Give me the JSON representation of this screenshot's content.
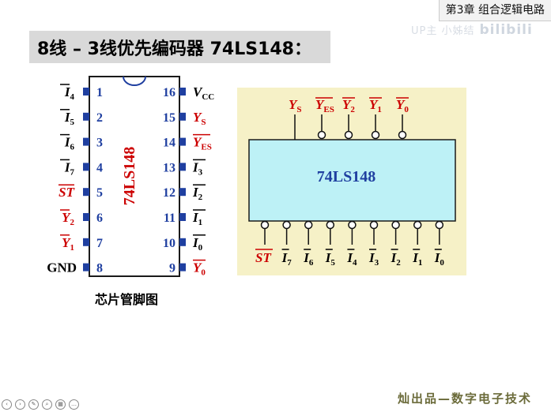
{
  "chapter": "第3章 组合逻辑电路",
  "watermark": {
    "text": "UP主 小姊结",
    "brand": "bilibili"
  },
  "title": "8线 – 3线优先编码器 74LS148：",
  "chip": {
    "name": "74LS148",
    "left_pins": [
      {
        "num": "1",
        "sig": "I",
        "sub": "4",
        "bar": true,
        "color": "#000000"
      },
      {
        "num": "2",
        "sig": "I",
        "sub": "5",
        "bar": true,
        "color": "#000000"
      },
      {
        "num": "3",
        "sig": "I",
        "sub": "6",
        "bar": true,
        "color": "#000000"
      },
      {
        "num": "4",
        "sig": "I",
        "sub": "7",
        "bar": true,
        "color": "#000000"
      },
      {
        "num": "5",
        "sig": "ST",
        "sub": "",
        "bar": true,
        "color": "#cc0000"
      },
      {
        "num": "6",
        "sig": "Y",
        "sub": "2",
        "bar": true,
        "color": "#cc0000"
      },
      {
        "num": "7",
        "sig": "Y",
        "sub": "1",
        "bar": true,
        "color": "#cc0000"
      },
      {
        "num": "8",
        "sig": "GND",
        "sub": "",
        "bar": false,
        "color": "#000000"
      }
    ],
    "right_pins": [
      {
        "num": "16",
        "sig": "V",
        "sub": "CC",
        "bar": false,
        "color": "#000000"
      },
      {
        "num": "15",
        "sig": "Y",
        "sub": "S",
        "bar": false,
        "color": "#cc0000"
      },
      {
        "num": "14",
        "sig": "Y",
        "sub": "ES",
        "bar": true,
        "color": "#cc0000"
      },
      {
        "num": "13",
        "sig": "I",
        "sub": "3",
        "bar": true,
        "color": "#000000"
      },
      {
        "num": "12",
        "sig": "I",
        "sub": "2",
        "bar": true,
        "color": "#000000"
      },
      {
        "num": "11",
        "sig": "I",
        "sub": "1",
        "bar": true,
        "color": "#000000"
      },
      {
        "num": "10",
        "sig": "I",
        "sub": "0",
        "bar": true,
        "color": "#000000"
      },
      {
        "num": "9",
        "sig": "Y",
        "sub": "0",
        "bar": true,
        "color": "#cc0000"
      }
    ]
  },
  "caption": "芯片管脚图",
  "logic": {
    "name": "74LS148",
    "outputs": [
      {
        "sig": "Y",
        "sub": "S",
        "bar": false,
        "bubble": false
      },
      {
        "sig": "Y",
        "sub": "ES",
        "bar": true,
        "bubble": true
      },
      {
        "sig": "Y",
        "sub": "2",
        "bar": true,
        "bubble": true
      },
      {
        "sig": "Y",
        "sub": "1",
        "bar": true,
        "bubble": true
      },
      {
        "sig": "Y",
        "sub": "0",
        "bar": true,
        "bubble": true
      }
    ],
    "inputs": [
      {
        "sig": "ST",
        "sub": "",
        "bar": true
      },
      {
        "sig": "I",
        "sub": "7",
        "bar": true
      },
      {
        "sig": "I",
        "sub": "6",
        "bar": true
      },
      {
        "sig": "I",
        "sub": "5",
        "bar": true
      },
      {
        "sig": "I",
        "sub": "4",
        "bar": true
      },
      {
        "sig": "I",
        "sub": "3",
        "bar": true
      },
      {
        "sig": "I",
        "sub": "2",
        "bar": true
      },
      {
        "sig": "I",
        "sub": "1",
        "bar": true
      },
      {
        "sig": "I",
        "sub": "0",
        "bar": true
      }
    ]
  },
  "colors": {
    "label_red": "#cc0000",
    "chip_blue": "#1f3fa0",
    "panel_bg": "#f6f1c7",
    "block_bg": "#bdf1f6"
  },
  "footer": "灿出品—数字电子技术"
}
